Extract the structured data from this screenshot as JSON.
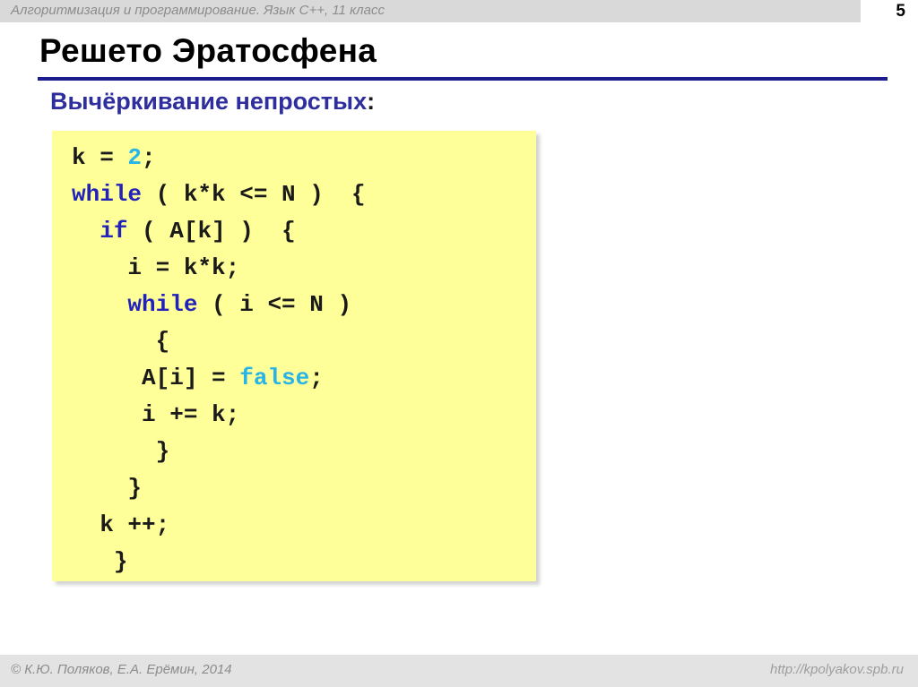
{
  "header": {
    "course_title": "Алгоритмизация и программирование. Язык C++, 11 класс",
    "slide_number": "5",
    "band_color": "#d9d9d9",
    "text_color": "#8c8c8c"
  },
  "title": {
    "text": "Решето Эратосфена",
    "rule_color": "#1c1c8c"
  },
  "subtitle": {
    "text": "Вычёркивание непростых",
    "colon": ":",
    "color": "#2e2e9e"
  },
  "code": {
    "background": "#ffff99",
    "keyword_color": "#2222bb",
    "literal_color": "#28b4e6",
    "text_color": "#1a1a1a",
    "lines": [
      {
        "indent": "",
        "segments": [
          {
            "t": "k = ",
            "c": "plain"
          },
          {
            "t": "2",
            "c": "lit"
          },
          {
            "t": ";",
            "c": "plain"
          }
        ]
      },
      {
        "indent": "",
        "segments": [
          {
            "t": "while",
            "c": "kw"
          },
          {
            "t": " ( k*k <= N )  {",
            "c": "plain"
          }
        ]
      },
      {
        "indent": "  ",
        "segments": [
          {
            "t": "if",
            "c": "kw"
          },
          {
            "t": " ( A[k] )  {",
            "c": "plain"
          }
        ]
      },
      {
        "indent": "    ",
        "segments": [
          {
            "t": "i = k*k;",
            "c": "plain"
          }
        ]
      },
      {
        "indent": "    ",
        "segments": [
          {
            "t": "while",
            "c": "kw"
          },
          {
            "t": " ( i <= N )",
            "c": "plain"
          }
        ]
      },
      {
        "indent": "      ",
        "segments": [
          {
            "t": "{",
            "c": "plain"
          }
        ]
      },
      {
        "indent": "     ",
        "segments": [
          {
            "t": "A[i] = ",
            "c": "plain"
          },
          {
            "t": "false",
            "c": "lit"
          },
          {
            "t": ";",
            "c": "plain"
          }
        ]
      },
      {
        "indent": "     ",
        "segments": [
          {
            "t": "i += k;",
            "c": "plain"
          }
        ]
      },
      {
        "indent": "      ",
        "segments": [
          {
            "t": "}",
            "c": "plain"
          }
        ]
      },
      {
        "indent": "    ",
        "segments": [
          {
            "t": "}",
            "c": "plain"
          }
        ]
      },
      {
        "indent": "  ",
        "segments": [
          {
            "t": "k ++;",
            "c": "plain"
          }
        ]
      },
      {
        "indent": "   ",
        "segments": [
          {
            "t": "}",
            "c": "plain"
          }
        ]
      }
    ]
  },
  "footer": {
    "copyright": "© К.Ю. Поляков, Е.А. Ерёмин, 2014",
    "url": "http://kpolyakov.spb.ru",
    "band_color": "#e3e3e3"
  }
}
